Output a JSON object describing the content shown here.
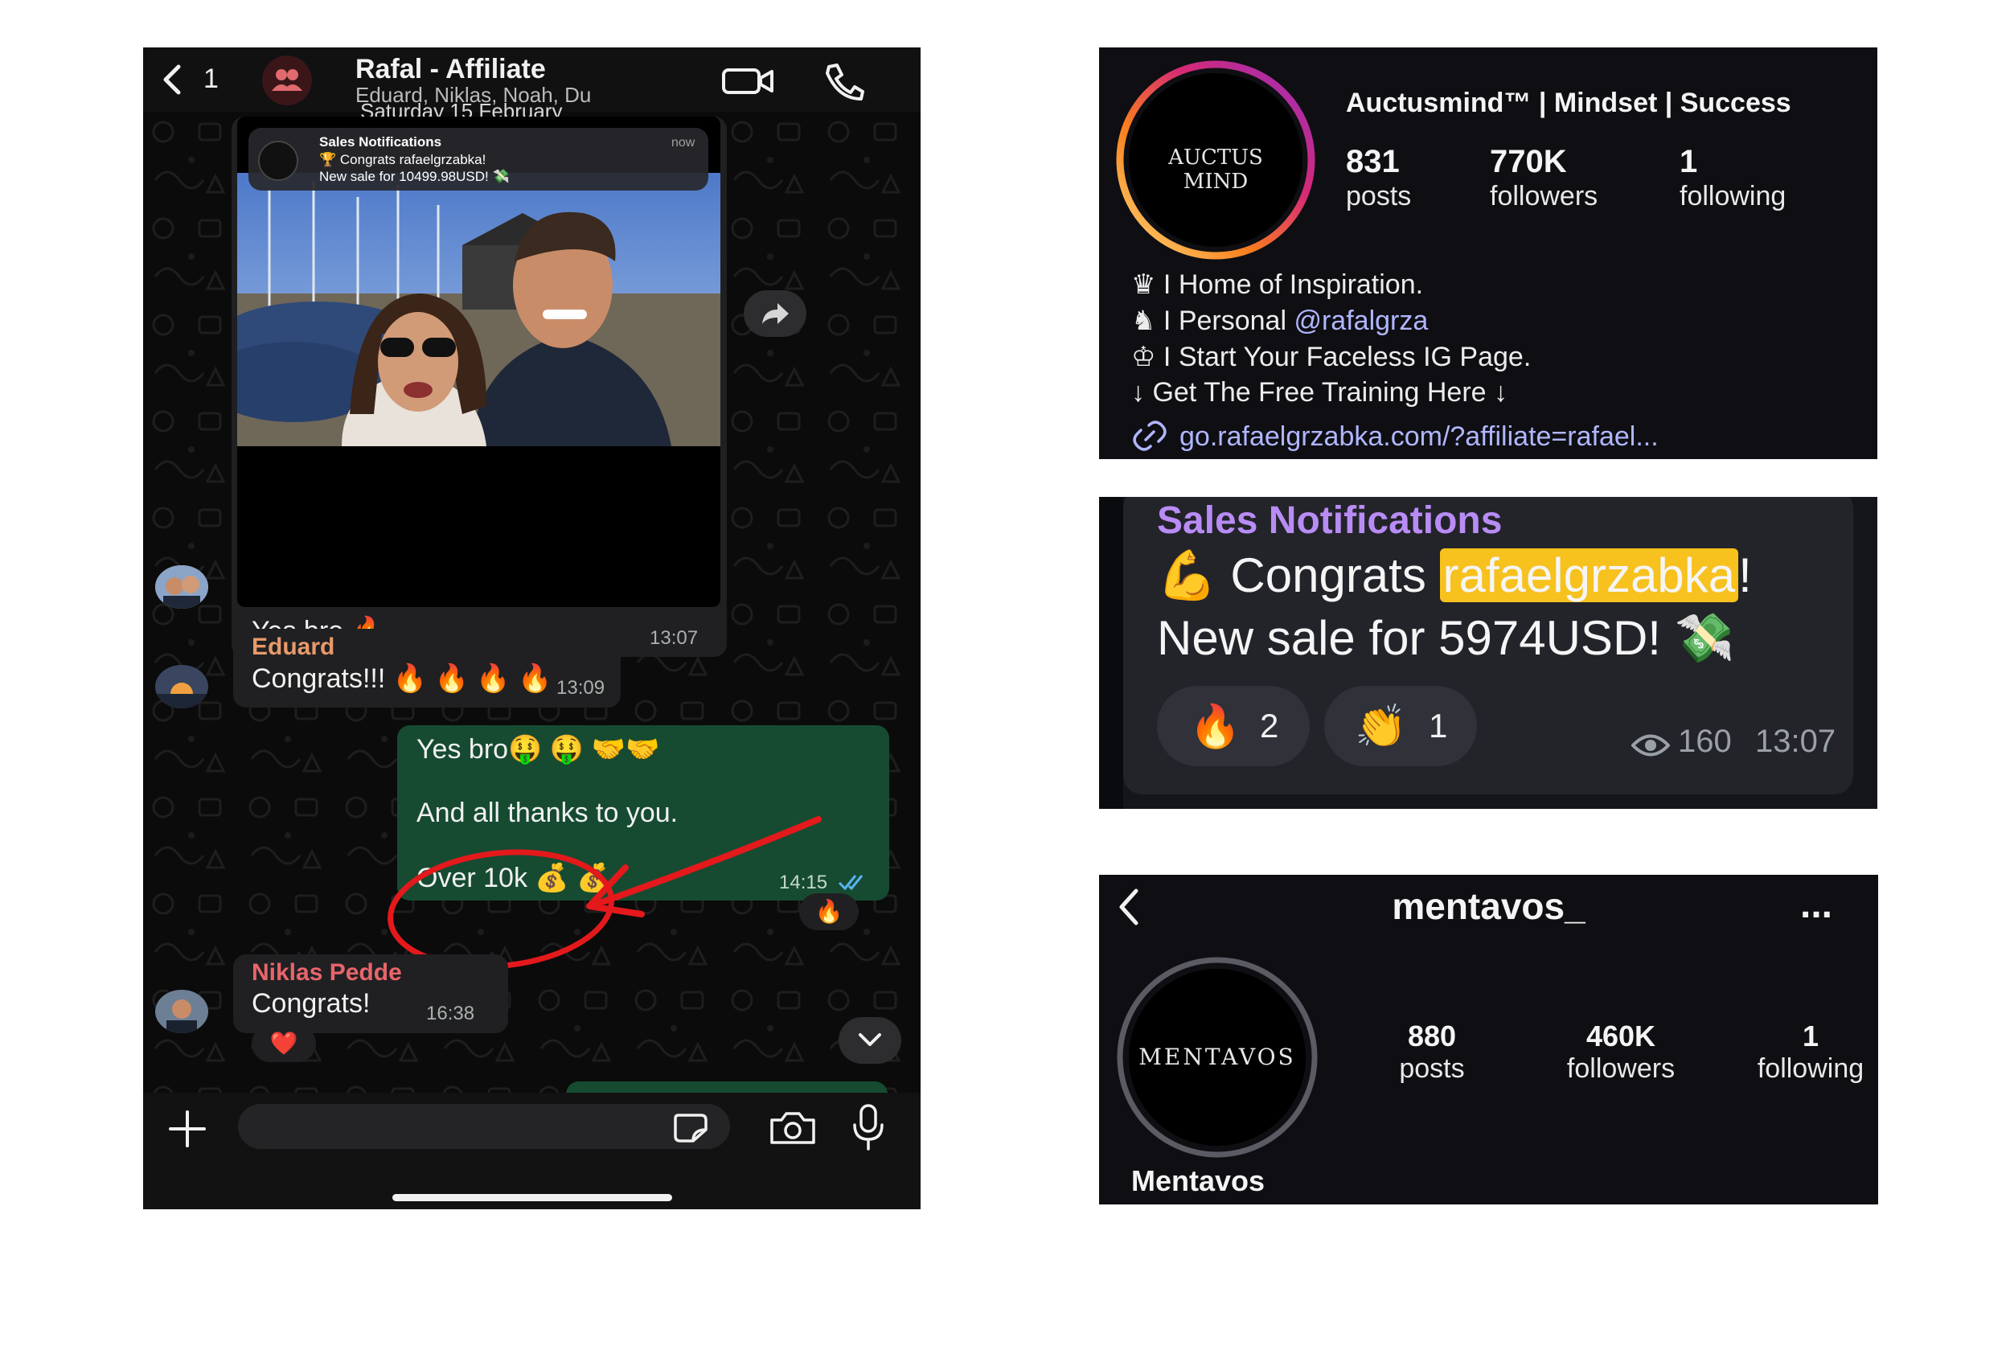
{
  "whatsapp": {
    "header": {
      "back_count": "1",
      "title": "Rafal - Affiliate",
      "members": "Eduard, Niklas, Noah, Du"
    },
    "date_divider": "Saturday 15 February",
    "notification": {
      "app": "Sales Notifications",
      "line1": "🏆 Congrats rafaelgrzabka!",
      "line2": "New sale for 10499.98USD! 💸",
      "time": "now"
    },
    "messages": [
      {
        "text": "Yes bro 🔥",
        "time": "13:07"
      },
      {
        "sender": "Eduard",
        "text": "Congrats!!! 🔥 🔥 🔥 🔥",
        "time": "13:09"
      },
      {
        "line1": "Yes bro🤑 🤑 🤝🤝",
        "line2": "And all thanks to you.",
        "line3": "Over 10k 💰 💰",
        "time": "14:15",
        "reaction": "🔥"
      },
      {
        "sender": "Niklas Pedde",
        "text": "Congrats!",
        "time": "16:38",
        "reaction": "❤️"
      }
    ],
    "icons": [
      "back-arrow",
      "group-avatar",
      "video-call",
      "phone",
      "forward",
      "scroll-down",
      "plus",
      "sticker",
      "camera",
      "microphone"
    ]
  },
  "instagram_auctus": {
    "avatar_text": "AUCTUS MIND",
    "name": "Auctusmind™ | Mindset | Success",
    "stats": [
      {
        "value": "831",
        "label": "posts"
      },
      {
        "value": "770K",
        "label": "followers"
      },
      {
        "value": "1",
        "label": "following"
      }
    ],
    "bio": {
      "line1": "♛ I Home of Inspiration.",
      "line2_prefix": "♞ I Personal ",
      "line2_handle": "@rafalgrza",
      "line3": "♔ I Start Your Faceless IG Page.",
      "line4": "↓ Get The Free Training Here ↓"
    },
    "link": "go.rafaelgrzabka.com/?affiliate=rafael..."
  },
  "telegram": {
    "channel": "Sales Notifications",
    "line1_prefix": "💪 Congrats ",
    "line1_name": "rafaelgrzabka",
    "line1_suffix": "!",
    "line2": "New sale for 5974USD! 💸",
    "reactions": [
      {
        "emoji": "🔥",
        "count": "2"
      },
      {
        "emoji": "👏",
        "count": "1"
      }
    ],
    "views": "160",
    "time": "13:07",
    "colors": {
      "channel": "#b98cf5",
      "highlight": "#f7c11e"
    }
  },
  "instagram_mentavos": {
    "username": "mentavos_",
    "avatar_text": "MENTAVOS",
    "display_name": "Mentavos",
    "stats": [
      {
        "value": "880",
        "label": "posts"
      },
      {
        "value": "460K",
        "label": "followers"
      },
      {
        "value": "1",
        "label": "following"
      }
    ],
    "menu": "..."
  }
}
